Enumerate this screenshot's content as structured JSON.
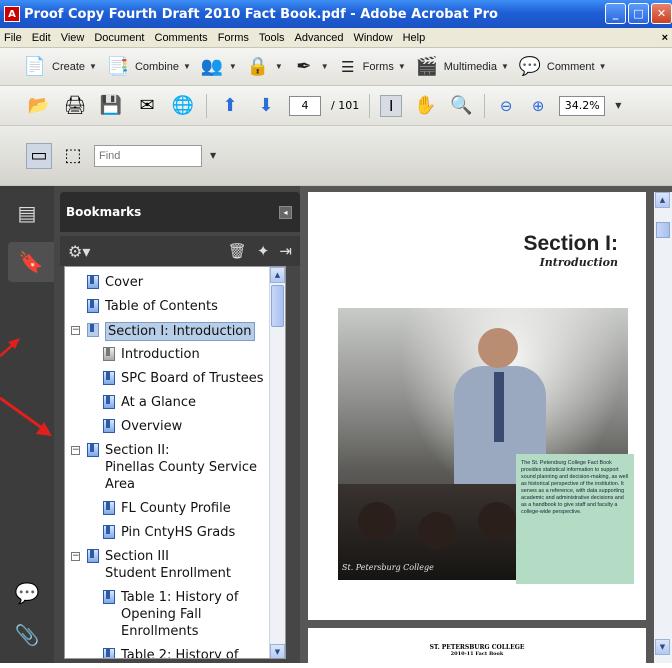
{
  "window": {
    "title": "Proof Copy Fourth Draft 2010 Fact Book.pdf - Adobe Acrobat Pro",
    "controls": [
      "_",
      "□",
      "✕"
    ]
  },
  "menu": [
    "File",
    "Edit",
    "View",
    "Document",
    "Comments",
    "Forms",
    "Tools",
    "Advanced",
    "Window",
    "Help"
  ],
  "menu_close": "×",
  "toolbar1": {
    "create": "Create",
    "combine": "Combine",
    "forms": "Forms",
    "multimedia": "Multimedia",
    "comment": "Comment"
  },
  "toolbar2": {
    "page_current": "4",
    "page_total": "/ 101",
    "zoom": "34.2%"
  },
  "toolbar3": {
    "find_placeholder": "Find"
  },
  "bookmarks": {
    "header": "Bookmarks",
    "items": [
      {
        "label": "Cover"
      },
      {
        "label": "Table of Contents"
      },
      {
        "label": "Section I: Introduction"
      },
      {
        "label": "Introduction"
      },
      {
        "label": "SPC Board of Trustees"
      },
      {
        "label": "At a Glance"
      },
      {
        "label": "Overview"
      },
      {
        "label": "Section II:"
      },
      {
        "label": "Pinellas County Service"
      },
      {
        "label": "Area"
      },
      {
        "label": "FL County Profile"
      },
      {
        "label": "Pin CntyHS Grads"
      },
      {
        "label": "Section III"
      },
      {
        "label": "Student Enrollment"
      },
      {
        "label": "Table 1:  History of"
      },
      {
        "label": "Opening Fall"
      },
      {
        "label": "Enrollments"
      },
      {
        "label": "Table 2:  History of"
      }
    ]
  },
  "document": {
    "section_title": "Section I:",
    "section_subtitle": "Introduction",
    "photo_caption": "St. Petersburg College",
    "green_box_text": "The St. Petersburg College Fact Book provides statistical information to support sound planning and decision-making, as well as historical perspective of the institution. It serves as a reference, with data supporting academic and administrative decisions and as a handbook to give staff and faculty a college-wide perspective.",
    "page2_line1": "ST. PETERSBURG COLLEGE",
    "page2_line2": "2010-11 Fact Book"
  },
  "colors": {
    "titlebar": "#1f5fd6",
    "panel_dark": "#464646",
    "selected_bookmark": "#b8cde8",
    "green_box": "#b4dcc4",
    "arrow_red": "#e0201c"
  }
}
